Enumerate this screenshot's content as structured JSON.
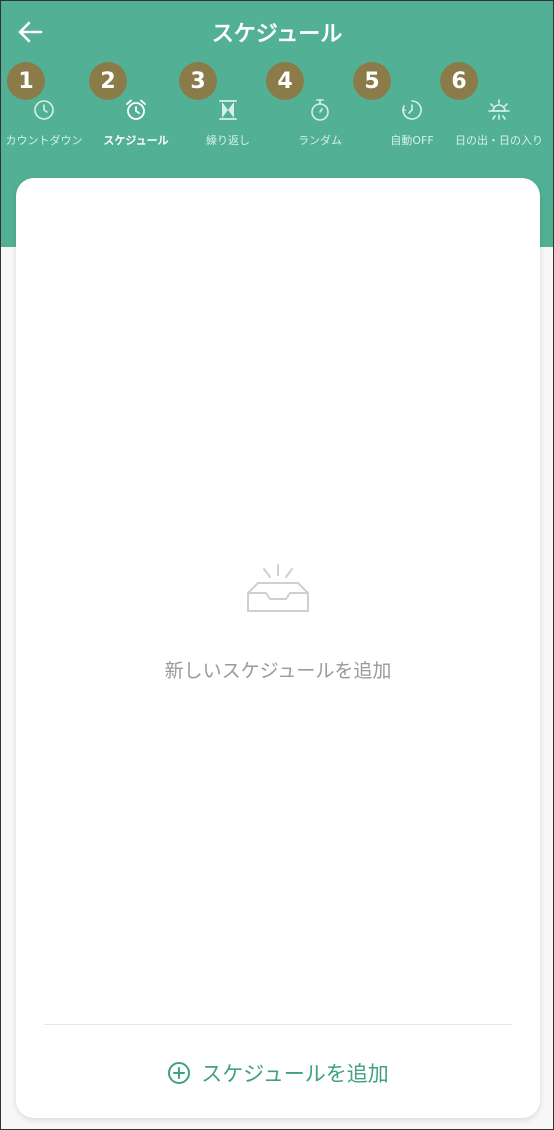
{
  "header": {
    "title": "スケジュール",
    "back_icon": "arrow-left-icon",
    "accent_color": "#52b194"
  },
  "badges": [
    "1",
    "2",
    "3",
    "4",
    "5",
    "6"
  ],
  "tabs": [
    {
      "label": "カウントダウン",
      "icon": "clock-icon",
      "active": false
    },
    {
      "label": "スケジュール",
      "icon": "alarm-clock-icon",
      "active": true
    },
    {
      "label": "繰り返し",
      "icon": "hourglass-icon",
      "active": false
    },
    {
      "label": "ランダム",
      "icon": "stopwatch-icon",
      "active": false
    },
    {
      "label": "自動OFF",
      "icon": "timer-off-icon",
      "active": false
    },
    {
      "label": "日の出・日の入り",
      "icon": "sunrise-icon",
      "active": false
    }
  ],
  "empty_state": {
    "icon": "empty-inbox-icon",
    "text": "新しいスケジュールを追加"
  },
  "add_button": {
    "icon": "plus-circle-icon",
    "label": "スケジュールを追加",
    "color": "#3fa17f"
  }
}
